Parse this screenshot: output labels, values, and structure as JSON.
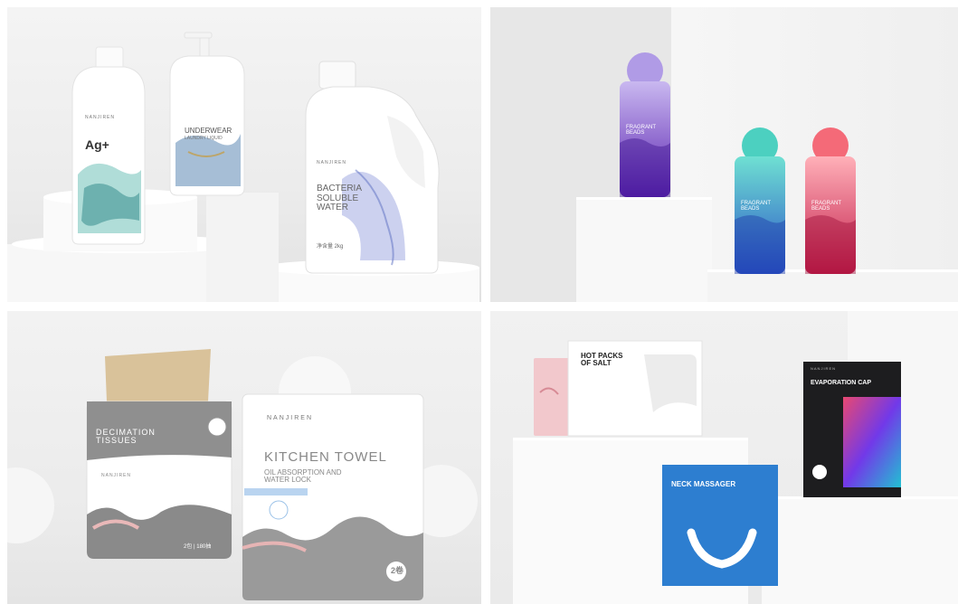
{
  "panel1": {
    "brand_a": "NANJIREN",
    "bottle_a_title": "Ag+",
    "bottle_b_title": "UNDERWEAR",
    "bottle_b_sub": "LAUNDRY LIQUID",
    "bottle_c_brand": "NANJIREN",
    "bottle_c_title": "BACTERIA\nSOLUBLE\nWATER",
    "bottle_c_net": "净含量 2kg"
  },
  "panel2": {
    "bottle_title": "FRAGRANT\nBEADS",
    "colors": {
      "purple": "#7a3fc8",
      "teal": "#2ec4b6",
      "coral": "#e8455f"
    }
  },
  "panel3": {
    "tissue_title": "DECIMATION\nTISSUES",
    "tissue_brand": "NANJIREN",
    "tissue_count": "2包 | 180抽",
    "towel_brand": "NANJIREN",
    "towel_title": "KITCHEN TOWEL",
    "towel_sub": "OIL ABSORPTION AND\nWATER LOCK",
    "towel_badge": "2卷"
  },
  "panel4": {
    "salt_title": "HOT PACKS\nOF SALT",
    "massager_title": "NECK MASSAGER",
    "cap_title": "EVAPORATION CAP",
    "cap_brand": "NANJIREN"
  }
}
